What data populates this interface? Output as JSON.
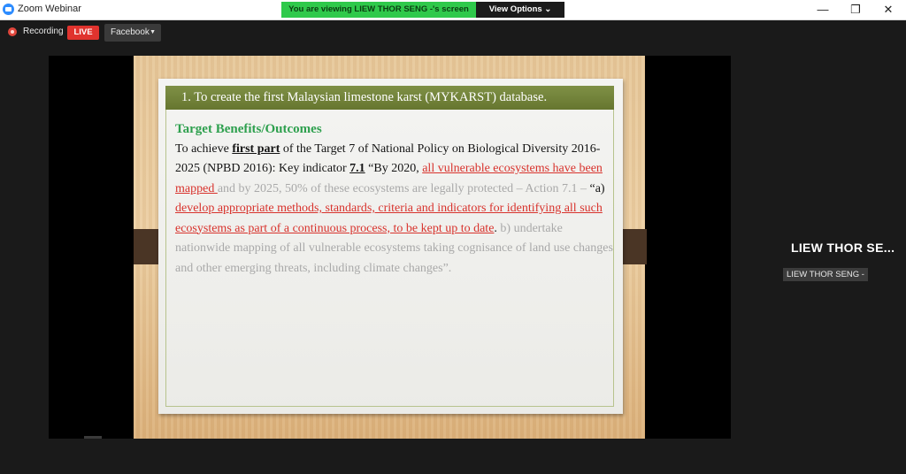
{
  "window": {
    "title": "Zoom Webinar",
    "banner": "You are viewing LIEW THOR SENG -'s screen",
    "view_options": "View Options ⌄"
  },
  "recording": {
    "label": "Recording",
    "live": "LIVE",
    "platform": "Facebook"
  },
  "slide": {
    "header": "1. To create the first Malaysian limestone karst (MYKARST) database.",
    "benefits_title": "Target Benefits/Outcomes",
    "p1_a": "To achieve ",
    "p1_b": "first part",
    "p1_c": " of the Target 7 of National Policy on Biological Diversity 2016-2025 (NPBD 2016): Key indicator ",
    "p1_d": "7.1",
    "p1_e": " “By 2020, ",
    "p1_red1": "all vulnerable ecosystems have been mapped ",
    "p1_grey1": "and by 2025, 50% of these ecosystems are legally protected – Action 7.1 – ",
    "p1_quote": "“a)",
    "p1_red2": " develop appropriate methods, standards, criteria and indicators for identifying all such ecosystems as part of a continuous process, to be kept up to date",
    "p1_dot": ".",
    "p1_grey2": " b) undertake nationwide mapping of all vulnerable ecosystems taking cognisance of land use changes and other emerging threats, including climate changes”."
  },
  "participant": {
    "tile_name": "LIEW THOR SE...",
    "label": "LIEW THOR SENG -"
  }
}
